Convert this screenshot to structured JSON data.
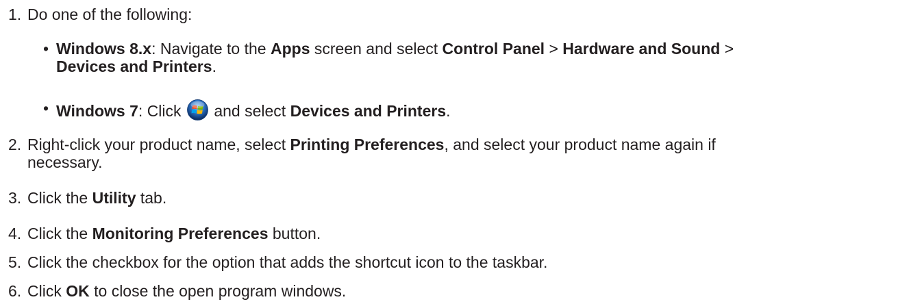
{
  "steps": [
    {
      "number": "1.",
      "text": "Do one of the following:",
      "substeps": [
        {
          "bullet": "•",
          "lines": [
            [
              {
                "t": "Windows 8.x",
                "b": true
              },
              {
                "t": ": Navigate to the ",
                "b": false
              },
              {
                "t": "Apps",
                "b": true
              },
              {
                "t": " screen and select ",
                "b": false
              },
              {
                "t": "Control Panel",
                "b": true
              },
              {
                "t": " > ",
                "b": false
              },
              {
                "t": "Hardware and Sound",
                "b": true
              },
              {
                "t": " >",
                "b": false
              }
            ],
            [
              {
                "t": "Devices and Printers",
                "b": true
              },
              {
                "t": ".",
                "b": false
              }
            ]
          ]
        },
        {
          "bullet": "•",
          "before_icon": [
            {
              "t": "Windows 7",
              "b": true
            },
            {
              "t": ": Click",
              "b": false
            }
          ],
          "icon": "windows-start-orb-icon",
          "after_icon": [
            {
              "t": " and select ",
              "b": false
            },
            {
              "t": "Devices and Printers",
              "b": true
            },
            {
              "t": ".",
              "b": false
            }
          ]
        }
      ]
    },
    {
      "number": "2.",
      "lines": [
        [
          {
            "t": "Right-click your product name, select ",
            "b": false
          },
          {
            "t": "Printing Preferences",
            "b": true
          },
          {
            "t": ", and select your product name again if",
            "b": false
          }
        ],
        [
          {
            "t": "necessary.",
            "b": false
          }
        ]
      ]
    },
    {
      "number": "3.",
      "lines": [
        [
          {
            "t": "Click the ",
            "b": false
          },
          {
            "t": "Utility",
            "b": true
          },
          {
            "t": " tab.",
            "b": false
          }
        ]
      ]
    },
    {
      "number": "4.",
      "lines": [
        [
          {
            "t": "Click the ",
            "b": false
          },
          {
            "t": "Monitoring Preferences",
            "b": true
          },
          {
            "t": " button.",
            "b": false
          }
        ]
      ]
    },
    {
      "number": "5.",
      "lines": [
        [
          {
            "t": "Click the checkbox for the option that adds the shortcut icon to the taskbar.",
            "b": false
          }
        ]
      ]
    },
    {
      "number": "6.",
      "lines": [
        [
          {
            "t": "Click ",
            "b": false
          },
          {
            "t": "OK",
            "b": true
          },
          {
            "t": " to close the open program windows.",
            "b": false
          }
        ]
      ]
    }
  ],
  "colors": {
    "text": "#231f20"
  }
}
